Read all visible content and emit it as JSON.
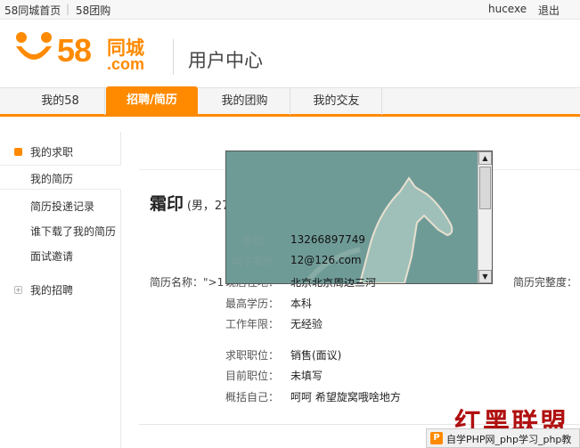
{
  "topbar": {
    "home_link": "58同城首页",
    "separator": "|",
    "groupbuy_link": "58团购",
    "username": "hucexe",
    "logout": "退出"
  },
  "header": {
    "logo_number": "58",
    "logo_cn": "同城",
    "logo_com": ".com",
    "title": "用户中心"
  },
  "nav": {
    "tabs": [
      {
        "label": "我的58"
      },
      {
        "label": "招聘/简历"
      },
      {
        "label": "我的团购"
      },
      {
        "label": "我的交友"
      }
    ],
    "active_index": 1
  },
  "sidebar": {
    "group1": "我的求职",
    "items": [
      "我的简历",
      "简历投递记录",
      "谁下载了我的简历",
      "面试邀请"
    ],
    "group2": "我的招聘"
  },
  "resume": {
    "name": "霜印",
    "meta": "(男，27岁)",
    "resume_name_label": "简历名称：\">1",
    "completeness_label": "简历完整度：",
    "fields": [
      {
        "label": "手机：",
        "value": "13266897749"
      },
      {
        "label": "电子邮件：",
        "value": "12@126.com"
      },
      {
        "label": "现居住地：",
        "value": "北京北京周边三河"
      },
      {
        "label": "最高学历：",
        "value": "本科"
      },
      {
        "label": "工作年限：",
        "value": "无经验"
      },
      {
        "label": "求职职位：",
        "value": "销售(面议)"
      },
      {
        "label": "目前职位：",
        "value": "未填写"
      },
      {
        "label": "概括自己：",
        "value": "呵呵 希望旋窝哦啥地方"
      }
    ]
  },
  "watermark": {
    "title": "红黑联盟",
    "badge": "P",
    "text": "自学PHP网_php学习_php教"
  },
  "colors": {
    "accent": "#ff8a00",
    "overlay": "#6e9a96",
    "watermark": "#b01010"
  }
}
